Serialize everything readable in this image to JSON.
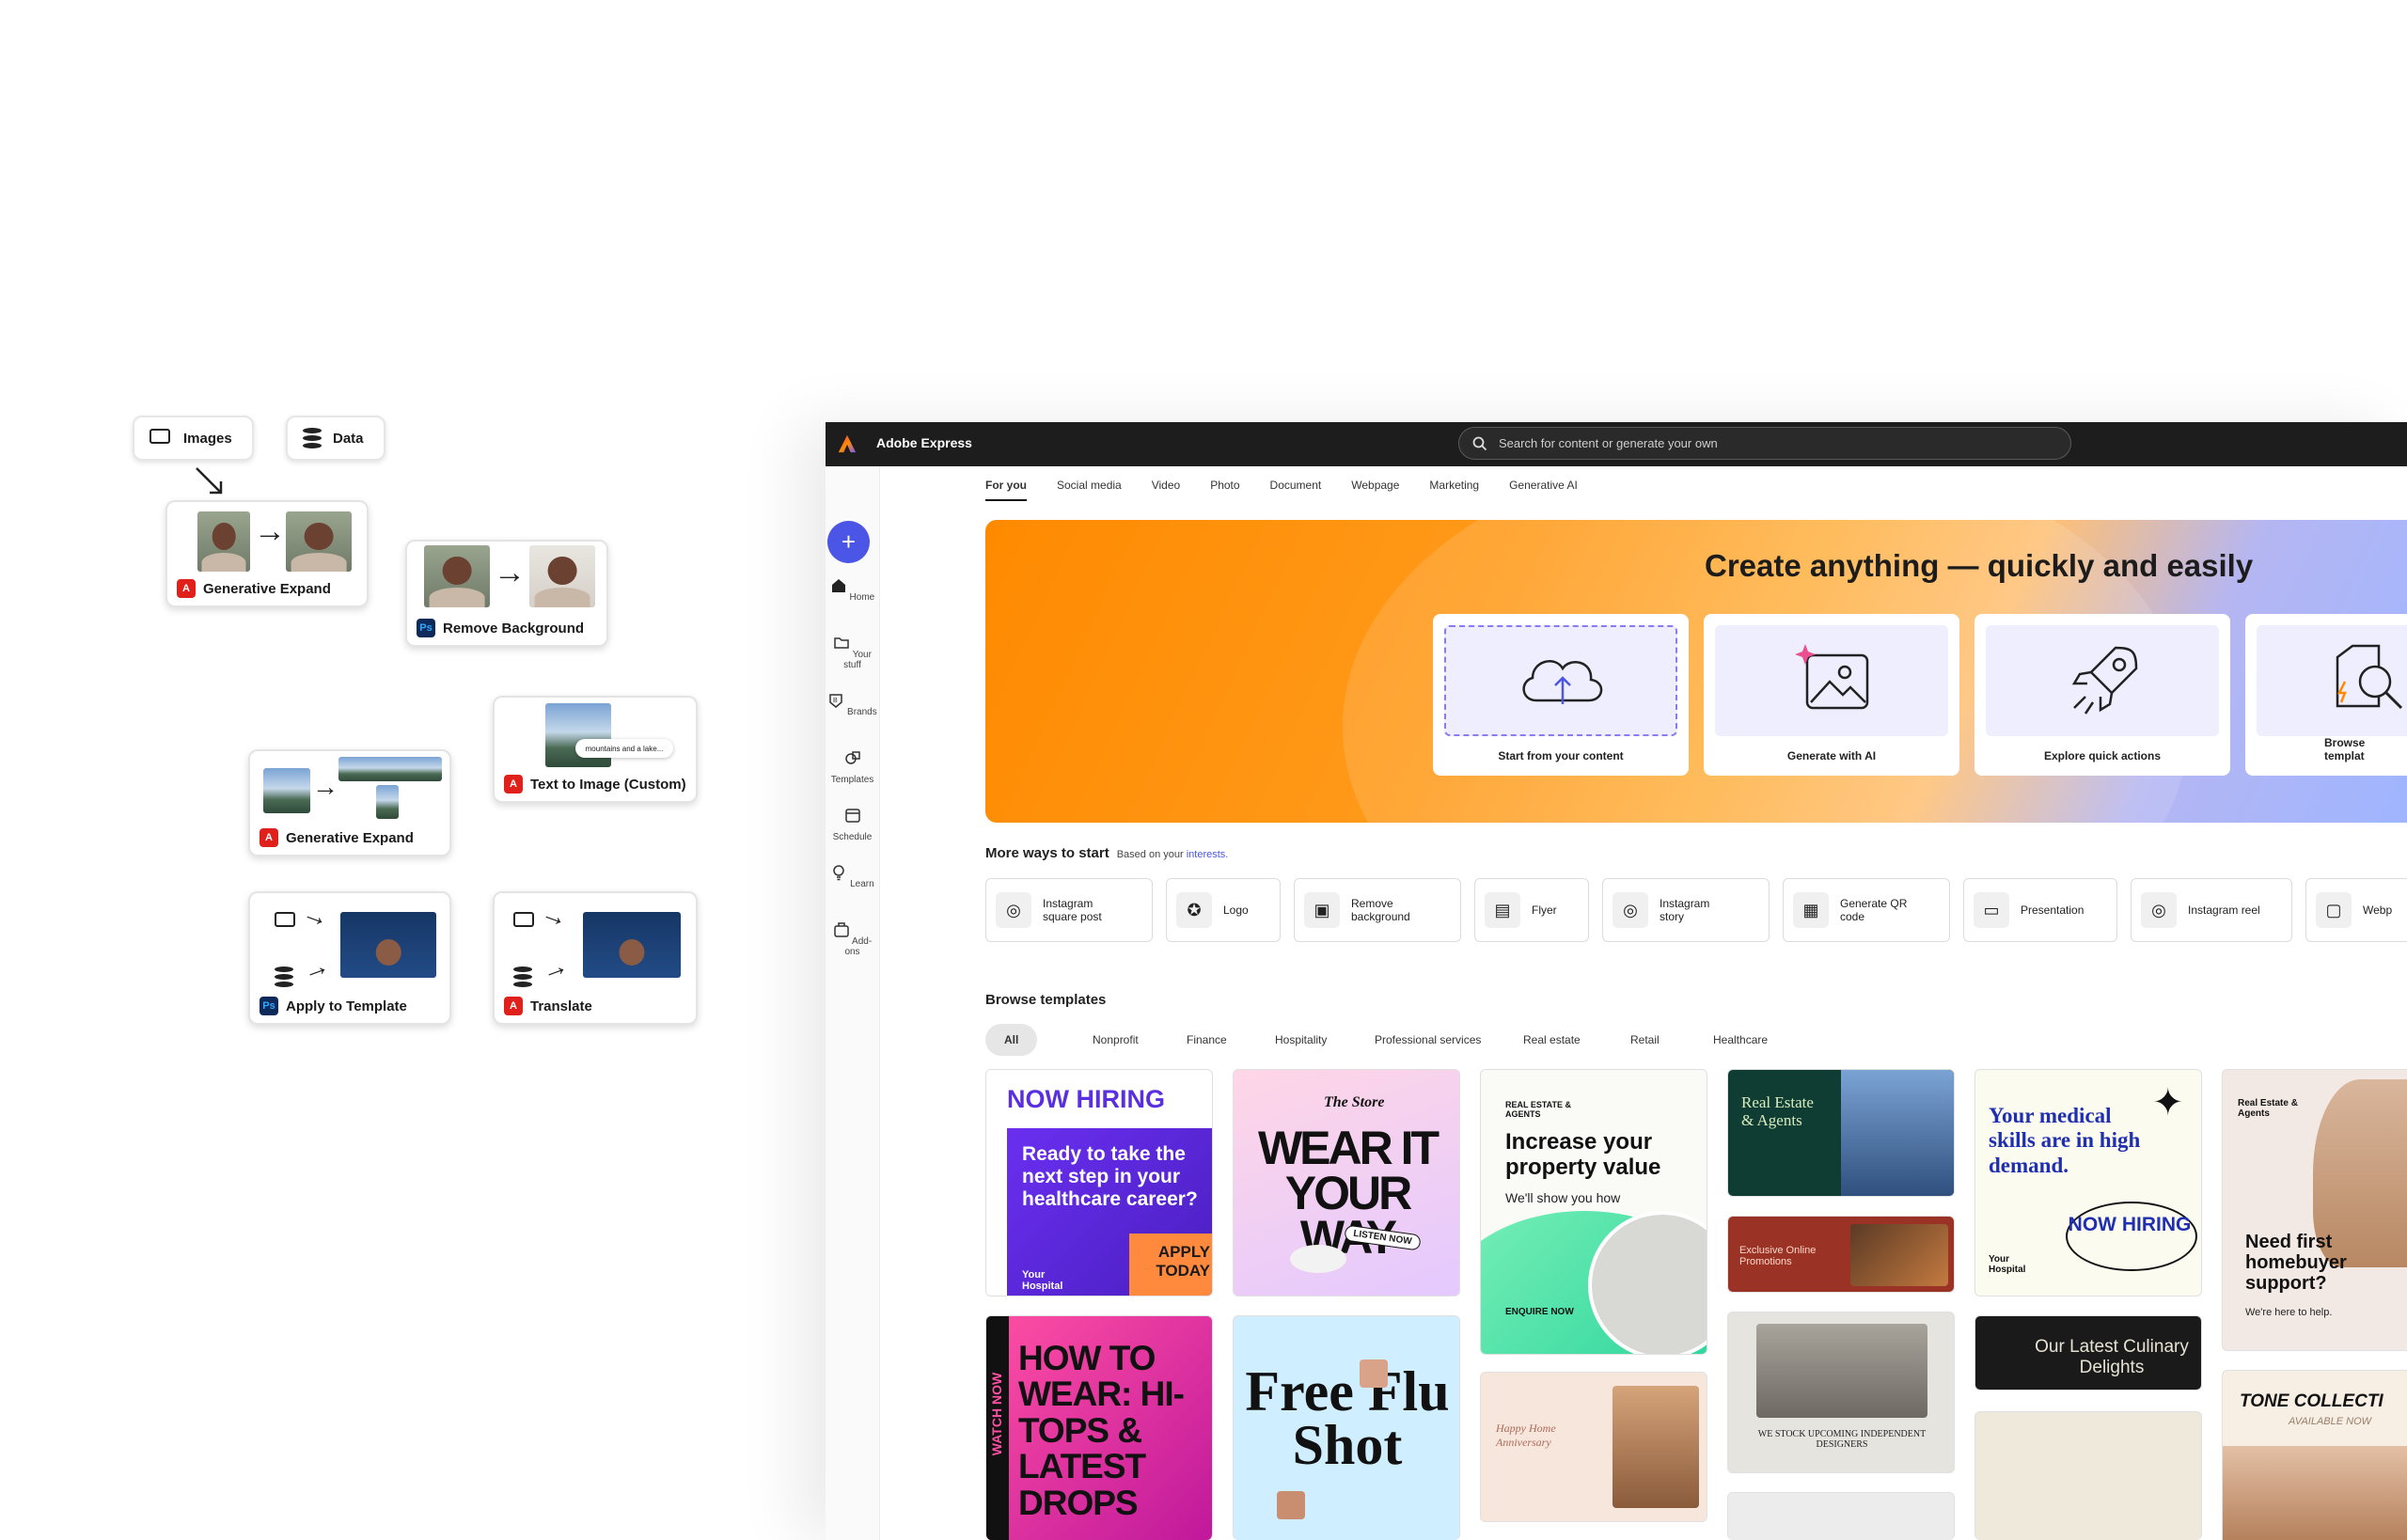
{
  "workflow": {
    "inputs": {
      "images": "Images",
      "data": "Data"
    },
    "nodes": {
      "gen_expand_1": "Generative Expand",
      "remove_bg": "Remove Background",
      "text_to_image": "Text to Image (Custom)",
      "text_to_image_prompt": "mountains and a lake...",
      "gen_expand_2": "Generative Expand",
      "apply_template": "Apply to Template",
      "translate": "Translate"
    },
    "badges": {
      "express": "A",
      "photoshop": "Ps"
    }
  },
  "app": {
    "title": "Adobe Express",
    "search_placeholder": "Search for content or generate your own",
    "rail": [
      "Home",
      "Your stuff",
      "Brands",
      "Templates",
      "Schedule",
      "Learn",
      "Add-ons"
    ],
    "tabs": [
      "For you",
      "Social media",
      "Video",
      "Photo",
      "Document",
      "Webpage",
      "Marketing",
      "Generative AI"
    ],
    "hero": {
      "title": "Create anything — quickly and easily",
      "cards": [
        "Start from your content",
        "Generate with AI",
        "Explore quick actions",
        "Browse templat"
      ]
    },
    "more_ways": {
      "title": "More ways to start",
      "subtitle": "Based on your",
      "link": "interests.",
      "items": [
        "Instagram square post",
        "Logo",
        "Remove background",
        "Flyer",
        "Instagram story",
        "Generate QR code",
        "Presentation",
        "Instagram reel",
        "Webp"
      ]
    },
    "browse": {
      "title": "Browse templates",
      "filters": [
        "All",
        "Nonprofit",
        "Finance",
        "Hospitality",
        "Professional services",
        "Real estate",
        "Retail",
        "Healthcare"
      ]
    },
    "templates": {
      "t1_head": "NOW HIRING",
      "t1_body": "Ready to take the next step in your healthcare career?",
      "t1_cta": "APPLY TODAY",
      "t1_org": "Your Hospital",
      "t2_store": "The Store",
      "t2_title": "WEAR IT YOUR WAY",
      "t2_cta": "LISTEN NOW",
      "t3_tag": "REAL ESTATE & AGENTS",
      "t3_title": "Increase your property value",
      "t3_sub": "We'll show you how",
      "t3_cta": "ENQUIRE NOW",
      "t4_title": "Real Estate & Agents",
      "t5_title": "Exclusive Online Promotions",
      "t6_title": "Your medical skills are in high demand.",
      "t6_cta": "NOW HIRING",
      "t6_org": "Your Hospital",
      "t7_title": "Need first homebuyer support?",
      "t7_sub": "We're here to help.",
      "t7_tag": "Real Estate & Agents",
      "t8_side": "WATCH NOW",
      "t8_title": "HOW TO WEAR: HI-TOPS & LATEST DROPS",
      "t9_title": "Free Flu Shot",
      "t10_title": "Happy Home Anniversary",
      "t11_title": "WE STOCK UPCOMING INDEPENDENT DESIGNERS",
      "t12_title": "Our Latest Culinary Delights",
      "t13_title": "TONE COLLECTI",
      "t13_sub": "AVAILABLE NOW"
    }
  }
}
